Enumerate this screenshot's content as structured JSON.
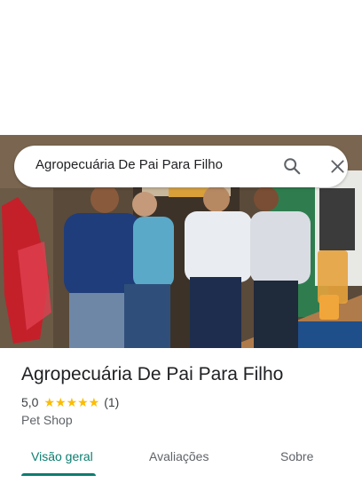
{
  "search": {
    "query": "Agropecuária De Pai Para Filho"
  },
  "place": {
    "name": "Agropecuária De Pai Para Filho",
    "rating": "5,0",
    "stars": "★★★★★",
    "review_count": "(1)",
    "category": "Pet Shop"
  },
  "tabs": [
    {
      "label": "Visão geral",
      "active": true
    },
    {
      "label": "Avaliações",
      "active": false
    },
    {
      "label": "Sobre",
      "active": false
    }
  ],
  "colors": {
    "accent": "#0b7e70",
    "star": "#fbbc04"
  },
  "icons": [
    "search-icon",
    "close-icon"
  ]
}
